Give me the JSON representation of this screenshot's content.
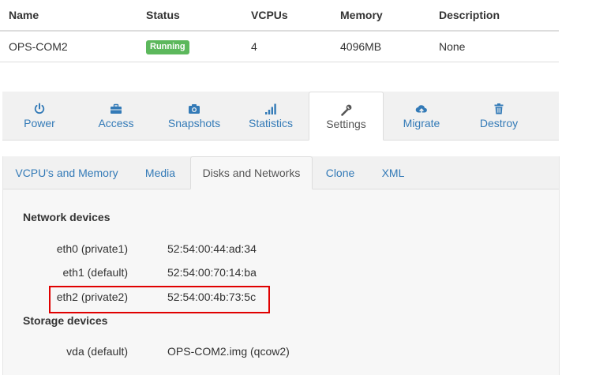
{
  "table": {
    "headers": [
      "Name",
      "Status",
      "VCPUs",
      "Memory",
      "Description"
    ],
    "row": {
      "name": "OPS-COM2",
      "status": "Running",
      "vcpus": "4",
      "memory": "4096MB",
      "description": "None"
    }
  },
  "main_tabs": [
    {
      "label": "Power",
      "icon": "power-icon"
    },
    {
      "label": "Access",
      "icon": "briefcase-icon"
    },
    {
      "label": "Snapshots",
      "icon": "camera-icon"
    },
    {
      "label": "Statistics",
      "icon": "signal-icon"
    },
    {
      "label": "Settings",
      "icon": "wrench-icon",
      "active": true
    },
    {
      "label": "Migrate",
      "icon": "cloud-upload-icon"
    },
    {
      "label": "Destroy",
      "icon": "trash-icon"
    }
  ],
  "sub_tabs": [
    {
      "label": "VCPU's and Memory"
    },
    {
      "label": "Media"
    },
    {
      "label": "Disks and Networks",
      "active": true
    },
    {
      "label": "Clone"
    },
    {
      "label": "XML"
    }
  ],
  "network": {
    "heading": "Network devices",
    "devices": [
      {
        "name": "eth0 (private1)",
        "mac": "52:54:00:44:ad:34"
      },
      {
        "name": "eth1 (default)",
        "mac": "52:54:00:70:14:ba"
      },
      {
        "name": "eth2 (private2)",
        "mac": "52:54:00:4b:73:5c"
      }
    ]
  },
  "storage": {
    "heading": "Storage devices",
    "devices": [
      {
        "name": "vda (default)",
        "file": "OPS-COM2.img (qcow2)"
      }
    ]
  },
  "colors": {
    "link": "#337ab7",
    "running_badge": "#5cb85c",
    "highlight": "#e00000"
  }
}
